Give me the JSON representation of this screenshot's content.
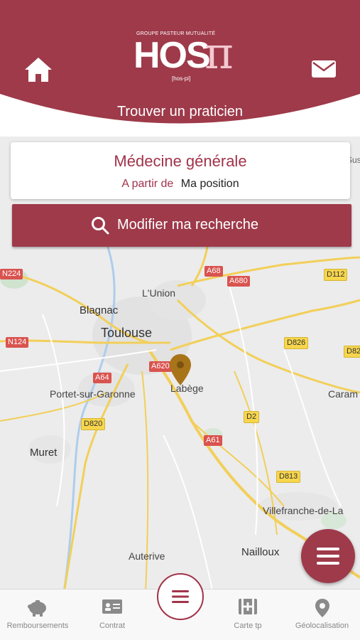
{
  "header": {
    "logo": {
      "group_text": "GROUPE PASTEUR MUTUALITÉ",
      "main_text": "HOS",
      "pi_symbol": "π",
      "phonetic": "[hos-pi]"
    },
    "title": "Trouver un praticien",
    "home_icon": "home-icon",
    "mail_icon": "mail-icon"
  },
  "search": {
    "specialty": "Médecine générale",
    "from_label": "A partir de",
    "from_value": "Ma position",
    "modify_label": "Modifier ma recherche",
    "modify_icon": "search-icon"
  },
  "map": {
    "places": {
      "lunion": "L'Union",
      "blagnac": "Blagnac",
      "toulouse": "Toulouse",
      "portet": "Portet-sur-Garonne",
      "labege": "Labège",
      "caram": "Caram",
      "muret": "Muret",
      "villefranche": "Villefranche-de-La",
      "nailloux": "Nailloux",
      "auterive": "Auterive",
      "sus": "Sus"
    },
    "roads": {
      "n224": "N224",
      "a68": "A68",
      "a680": "A680",
      "d112": "D112",
      "n124": "N124",
      "d826": "D826",
      "d82": "D82",
      "a64": "A64",
      "a620": "A620",
      "d2": "D2",
      "d820": "D820",
      "a61": "A61",
      "d813": "D813"
    }
  },
  "fab_icon": "menu-icon",
  "bottom_nav": {
    "items": [
      {
        "label": "Remboursements",
        "icon": "piggy-bank-icon"
      },
      {
        "label": "Contrat",
        "icon": "id-card-icon"
      },
      {
        "label": "Carte tp",
        "icon": "card-plus-icon"
      },
      {
        "label": "Géolocalisation",
        "icon": "location-pin-icon"
      }
    ],
    "center_icon": "menu-icon"
  },
  "colors": {
    "brand": "#9e3a4a",
    "brand_text": "#a1334a",
    "logo_pi": "#f4c8d0",
    "map_bg": "#ececec",
    "marker": "#a8741a",
    "nav_label": "#888888"
  }
}
